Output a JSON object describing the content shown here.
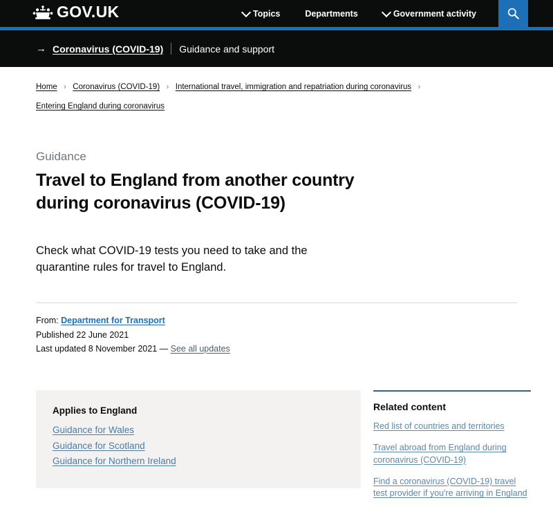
{
  "header": {
    "logo_text": "GOV.UK",
    "logo_icon": "crown-icon",
    "nav": [
      {
        "label": "Topics",
        "has_chevron": true
      },
      {
        "label": "Departments",
        "has_chevron": false
      },
      {
        "label": "Government activity",
        "has_chevron": true
      }
    ],
    "search_icon": "search-icon",
    "accent_color": "#1d70b8",
    "background_color": "#0b0c0c"
  },
  "covid_banner": {
    "arrow": "→",
    "link_label": "Coronavirus (COVID-19)",
    "subtitle": "Guidance and support"
  },
  "breadcrumbs": {
    "separator": "›",
    "items": [
      {
        "label": "Home"
      },
      {
        "label": "Coronavirus (COVID-19)"
      },
      {
        "label": "International travel, immigration and repatriation during coronavirus"
      },
      {
        "label": "Entering England during coronavirus"
      }
    ]
  },
  "main": {
    "document_type": "Guidance",
    "title": "Travel to England from another country during coronavirus (COVID-19)",
    "lede": "Check what COVID-19 tests you need to take and the quarantine rules for travel to England.",
    "metadata": {
      "from_label": "From:",
      "from_org": "Department for Transport",
      "published_label": "Published",
      "published_date": "22 June 2021",
      "last_updated_label": "Last updated",
      "last_updated_date": "8 November 2021",
      "updates_separator": "—",
      "updates_link": "See all updates"
    }
  },
  "applies_box": {
    "title": "Applies to England",
    "links": [
      {
        "label": "Guidance for Wales"
      },
      {
        "label": "Guidance for Scotland"
      },
      {
        "label": "Guidance for Northern Ireland"
      }
    ]
  },
  "related_content": {
    "title": "Related content",
    "links": [
      {
        "label": "Red list of countries and territories"
      },
      {
        "label": "Travel abroad from England during coronavirus (COVID-19)"
      },
      {
        "label": "Find a coronavirus (COVID-19) travel test provider if you're arriving in England"
      }
    ]
  }
}
